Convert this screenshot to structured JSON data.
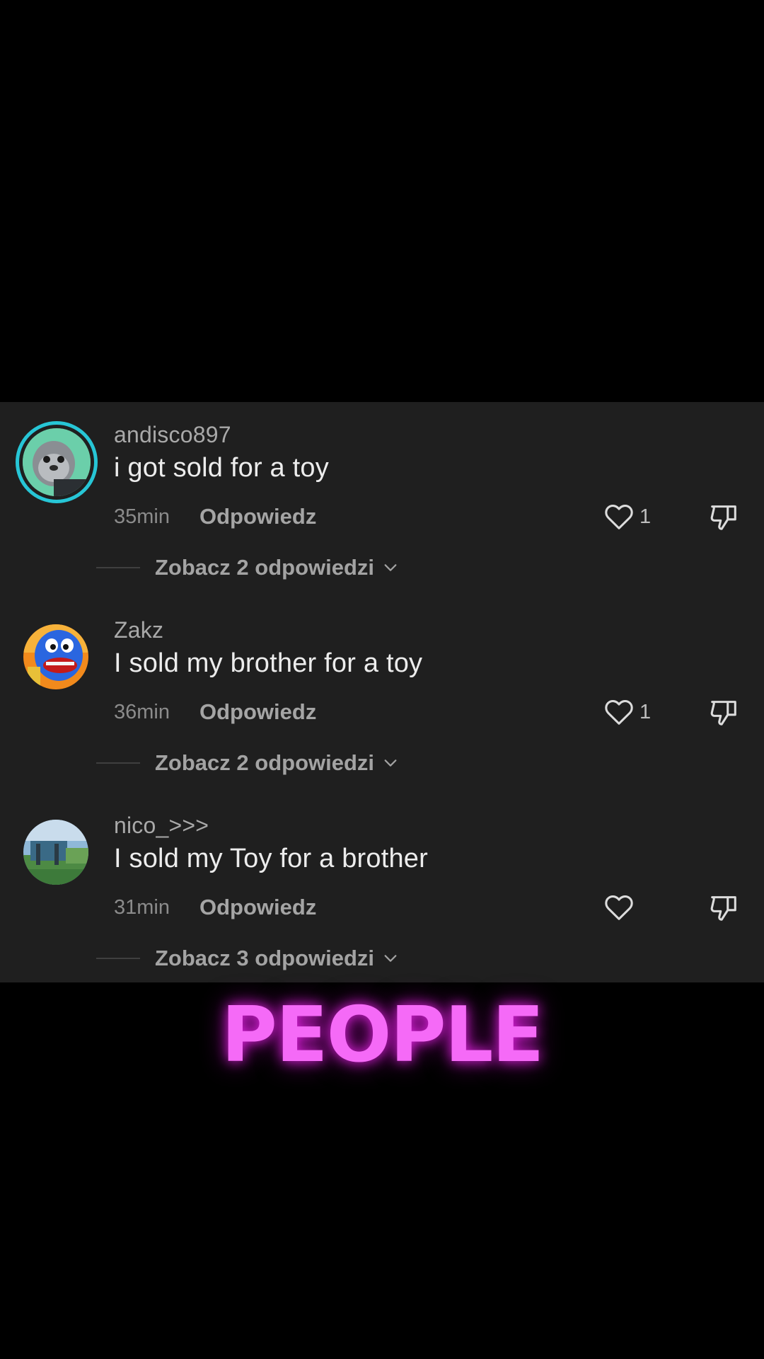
{
  "comments": [
    {
      "username": "andisco897",
      "text": "i got sold for a toy",
      "time": "35min",
      "reply_label": "Odpowiedz",
      "likes": "1",
      "view_replies": "Zobacz 2 odpowiedzi",
      "avatar_style": "story-ring"
    },
    {
      "username": "Zakz",
      "text": "I sold my brother for a toy",
      "time": "36min",
      "reply_label": "Odpowiedz",
      "likes": "1",
      "view_replies": "Zobacz 2 odpowiedzi",
      "avatar_style": "plain"
    },
    {
      "username": "nico_>>>",
      "text": "I sold my Toy for a brother",
      "time": "31min",
      "reply_label": "Odpowiedz",
      "likes": "",
      "view_replies": "Zobacz 3 odpowiedzi",
      "avatar_style": "plain"
    }
  ],
  "caption": "PEOPLE",
  "colors": {
    "panel_background": "#1f1f1f",
    "story_ring": "#27c6d6",
    "caption": "#f56af7",
    "caption_glow": "#ff28ff"
  },
  "icons": [
    "heart-icon",
    "thumbs-down-icon",
    "chevron-down-icon"
  ]
}
